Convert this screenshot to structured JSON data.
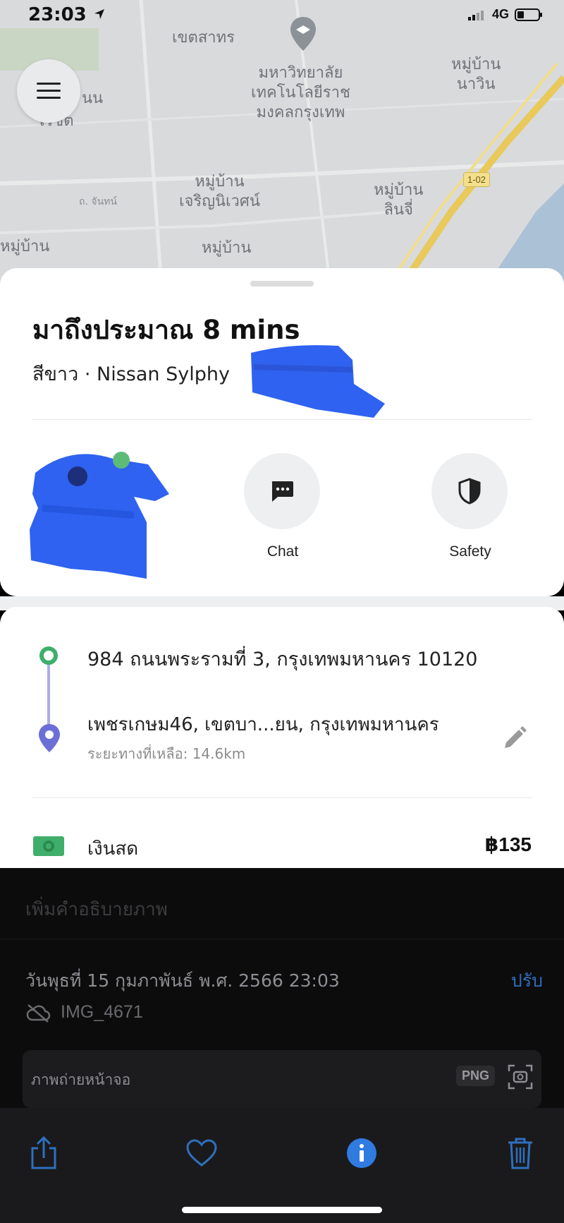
{
  "status_bar": {
    "time": "23:03",
    "network": "4G"
  },
  "map": {
    "labels": [
      "เขตสาทร",
      "มหาวิทยาลัย\nเทคโนโลยีราช\nมงคลกรุงเทพ",
      "หมู่บ้าน\nนาวิน",
      "หมู่บ้าน\nเจริญนิเวศน์",
      "หมู่บ้าน\nลินจี่",
      "หมู่บ้าน",
      "หมู่บ้าน",
      "นน",
      "เรชิต"
    ],
    "small_label": "ถ. จันทน์",
    "route_badge": "1-02"
  },
  "trip": {
    "eta": "มาถึงประมาณ 8 mins",
    "car": "สีขาว · Nissan Sylphy",
    "actions": [
      {
        "label": "Chat",
        "icon": "chat-icon"
      },
      {
        "label": "Safety",
        "icon": "shield-icon"
      }
    ]
  },
  "route": {
    "pickup": "984 ถนนพระรามที่ 3, กรุงเทพมหานคร 10120",
    "dropoff": "เพชรเกษม46, เขตบา...ยน, กรุงเทพมหานคร",
    "remaining": "ระยะทางที่เหลือ: 14.6km"
  },
  "payment": {
    "method": "เงินสด",
    "price": "฿135"
  },
  "photos": {
    "caption_placeholder": "เพิ่มคำอธิบายภาพ",
    "date": "วันพุธที่ 15 กุมภาพันธ์ พ.ศ. 2566 23:03",
    "adjust": "ปรับ",
    "filename": "IMG_4671",
    "card_label": "ภาพถ่ายหน้าจอ",
    "format_badge": "PNG"
  },
  "colors": {
    "accent_green": "#3fae6a",
    "route_purple": "#6b6fd6",
    "ios_blue": "#2f6fbd",
    "redaction_blue": "#2f62f0"
  }
}
